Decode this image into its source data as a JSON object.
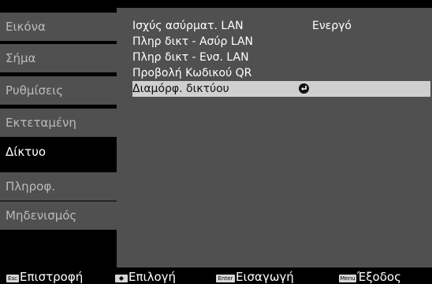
{
  "sidebar": {
    "items": [
      {
        "label": "Εικόνα"
      },
      {
        "label": "Σήμα"
      },
      {
        "label": "Ρυθμίσεις"
      },
      {
        "label": "Εκτεταμένη"
      },
      {
        "label": "Δίκτυο"
      },
      {
        "label": "Πληροφ."
      },
      {
        "label": "Μηδενισμός"
      }
    ],
    "active_index": 4
  },
  "panel": {
    "rows": [
      {
        "label": "Ισχύς ασύρματ. LAN",
        "value": "Ενεργό"
      },
      {
        "label": "Πληρ δικτ - Ασύρ LAN"
      },
      {
        "label": "Πληρ δικτ - Ενσ. LAN"
      },
      {
        "label": "Προβολή Κωδικού QR"
      },
      {
        "label": "Διαμόρφ. δικτύου",
        "icon": "enter-icon"
      }
    ],
    "selected_index": 4
  },
  "footer": {
    "esc_key": "Esc",
    "esc_label": "Επιστροφή",
    "select_key": "◆",
    "select_label": "Επιλογή",
    "enter_key": "Enter",
    "enter_label": "Εισαγωγή",
    "menu_key": "Menu",
    "menu_label": "Έξοδος"
  },
  "colors": {
    "background": "#000000",
    "panel": "#505050",
    "selection": "#cfcfcf",
    "inactive_text": "#bbbbbb"
  }
}
